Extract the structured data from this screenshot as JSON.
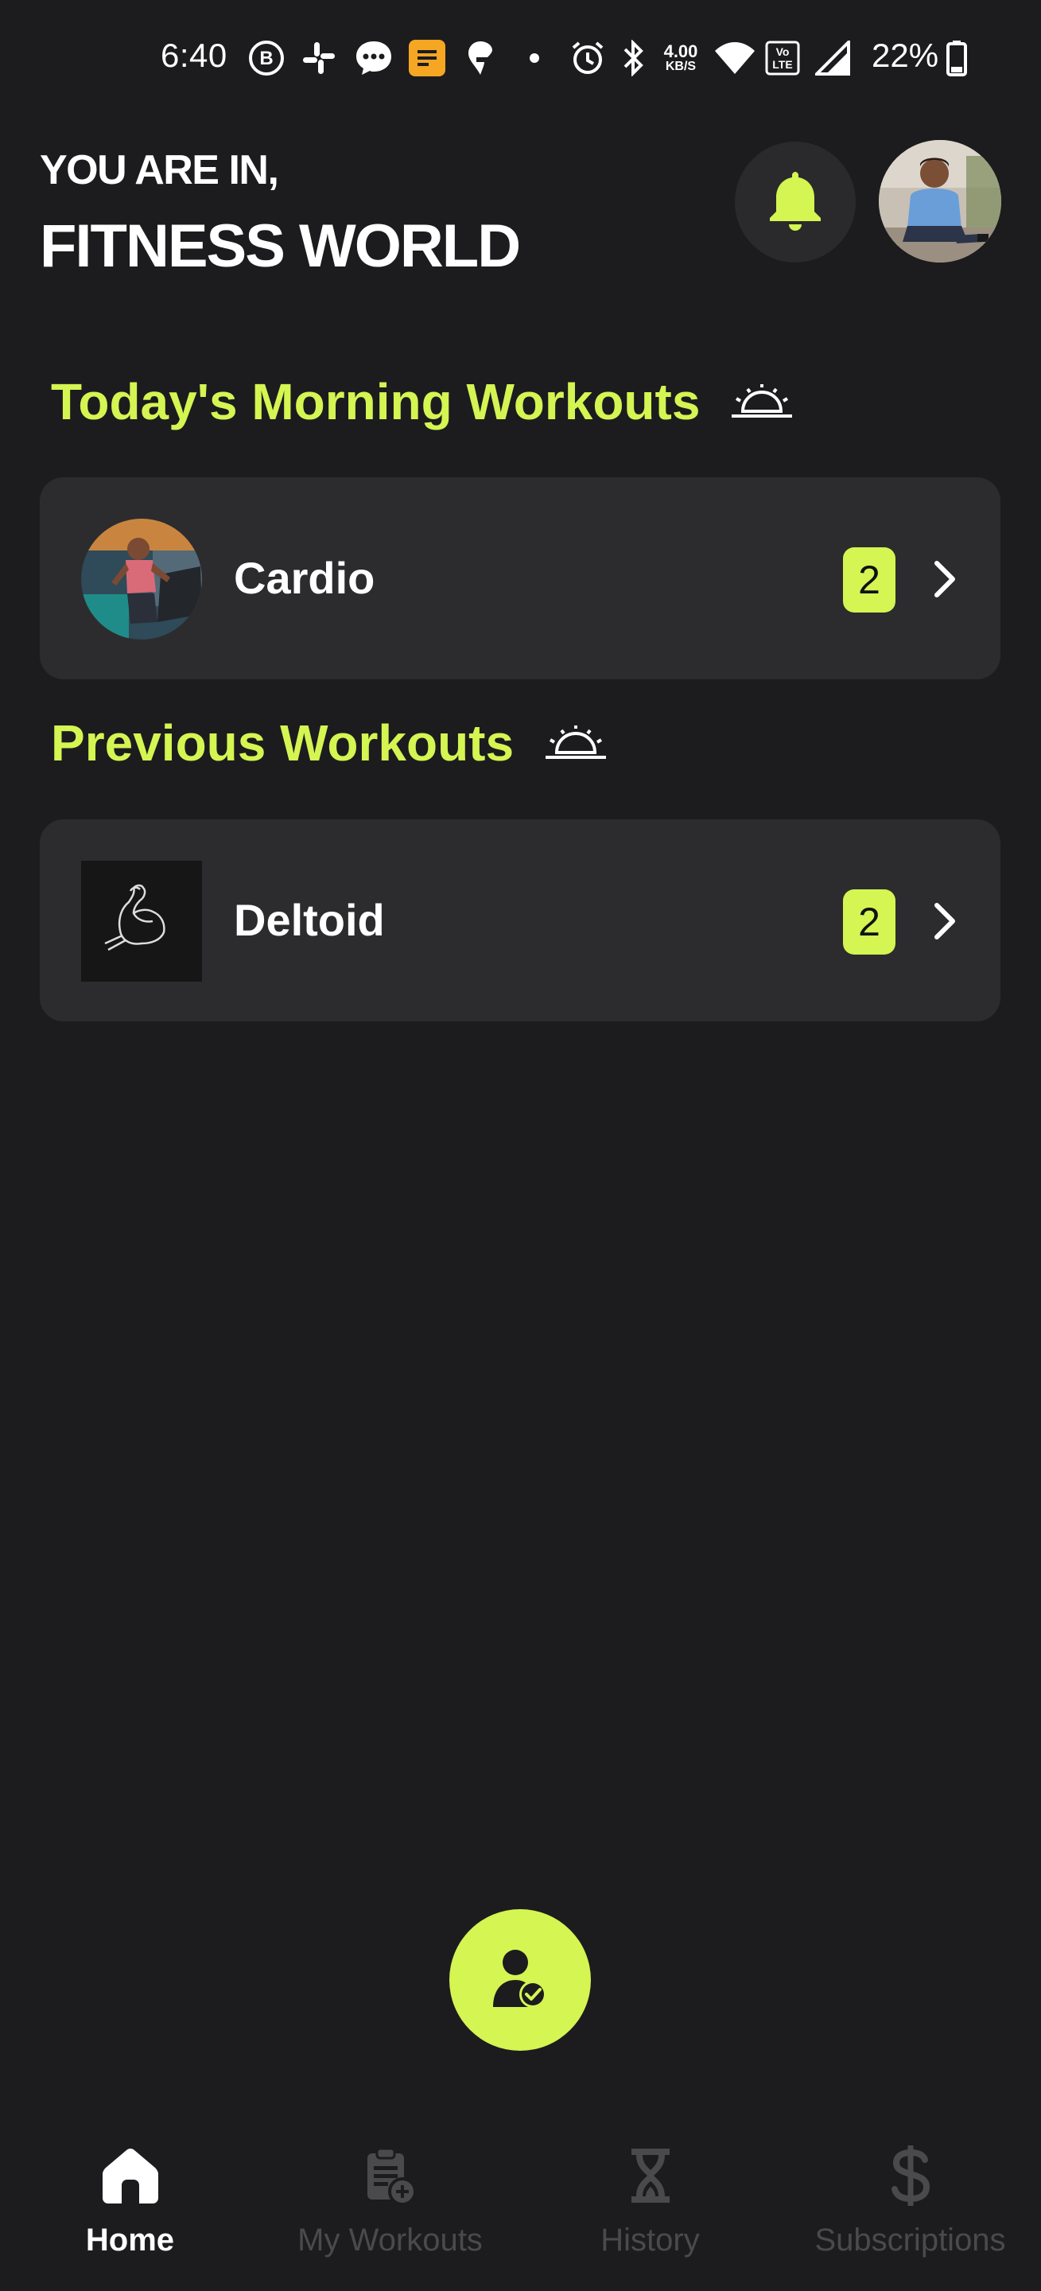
{
  "status_bar": {
    "time": "6:40",
    "net_speed_value": "4.00",
    "net_speed_unit": "KB/S",
    "volte": "Vo LTE",
    "battery_percent": "22%"
  },
  "header": {
    "greeting_line1": "YOU ARE IN,",
    "greeting_line2": "FITNESS WORLD"
  },
  "sections": {
    "today": {
      "title": "Today's Morning Workouts",
      "workout": {
        "label": "Cardio",
        "count": "2"
      }
    },
    "previous": {
      "title": "Previous Workouts",
      "workout": {
        "label": "Deltoid",
        "count": "2"
      }
    }
  },
  "nav": {
    "home": "Home",
    "my_workouts": "My Workouts",
    "history": "History",
    "subscriptions": "Subscriptions"
  },
  "colors": {
    "accent": "#d4f552",
    "background": "#1c1c1e",
    "card": "#2c2c2e",
    "nav_inactive": "#4a4a4c"
  },
  "icons": {
    "notifications": "bell-icon",
    "fab": "user-check-icon",
    "section": "sunrise-icon"
  }
}
